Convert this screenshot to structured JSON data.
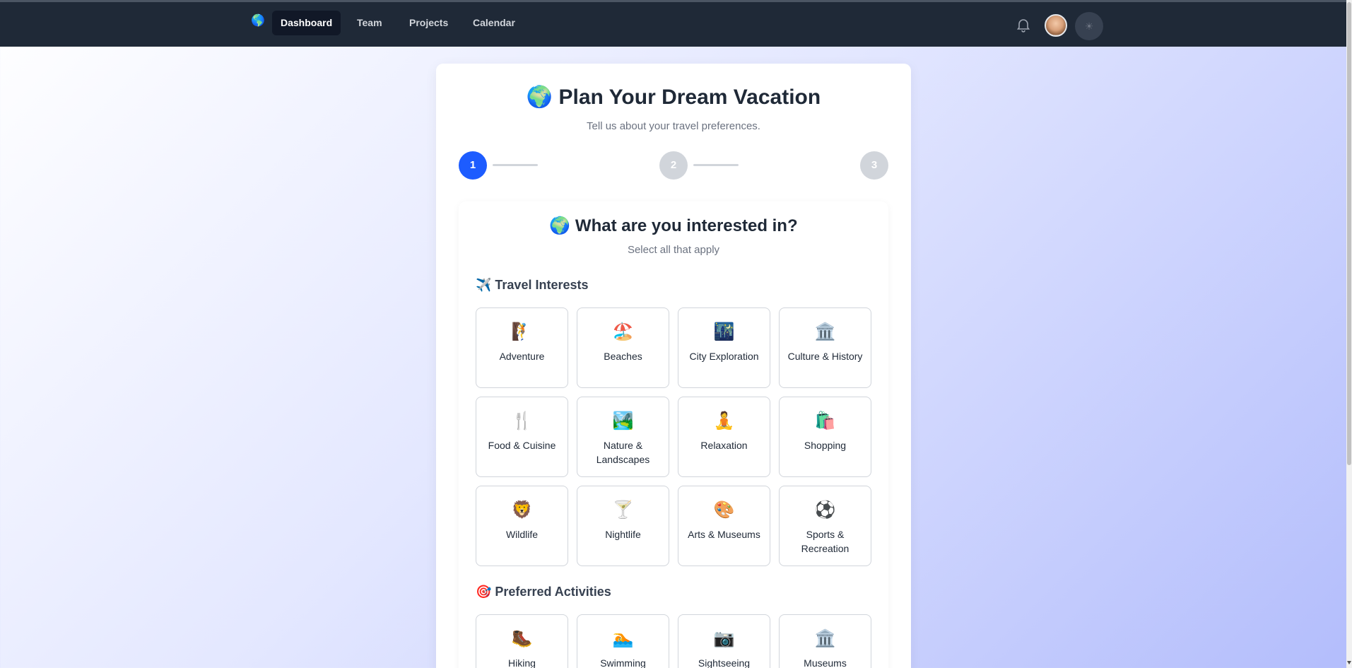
{
  "nav": {
    "logo_icon": "🌎",
    "items": [
      {
        "label": "Dashboard",
        "active": true
      },
      {
        "label": "Team",
        "active": false
      },
      {
        "label": "Projects",
        "active": false
      },
      {
        "label": "Calendar",
        "active": false
      }
    ],
    "theme_icon": "☀"
  },
  "page": {
    "title": "🌍 Plan Your Dream Vacation",
    "subtitle": "Tell us about your travel preferences."
  },
  "steps": [
    "1",
    "2",
    "3"
  ],
  "current_step": 1,
  "question": {
    "title": "🌍 What are you interested in?",
    "subtitle": "Select all that apply"
  },
  "sections": {
    "interests": {
      "heading": "✈️ Travel Interests",
      "items": [
        {
          "icon": "🧗",
          "label": "Adventure"
        },
        {
          "icon": "🏖️",
          "label": "Beaches"
        },
        {
          "icon": "🌃",
          "label": "City Exploration"
        },
        {
          "icon": "🏛️",
          "label": "Culture & History"
        },
        {
          "icon": "🍴",
          "label": "Food & Cuisine"
        },
        {
          "icon": "🏞️",
          "label": "Nature & Landscapes"
        },
        {
          "icon": "🧘",
          "label": "Relaxation"
        },
        {
          "icon": "🛍️",
          "label": "Shopping"
        },
        {
          "icon": "🦁",
          "label": "Wildlife"
        },
        {
          "icon": "🍸",
          "label": "Nightlife"
        },
        {
          "icon": "🎨",
          "label": "Arts & Museums"
        },
        {
          "icon": "⚽",
          "label": "Sports & Recreation"
        }
      ]
    },
    "activities": {
      "heading": "🎯 Preferred Activities",
      "items": [
        {
          "icon": "🥾",
          "label": "Hiking"
        },
        {
          "icon": "🏊",
          "label": "Swimming"
        },
        {
          "icon": "📷",
          "label": "Sightseeing"
        },
        {
          "icon": "🏛️",
          "label": "Museums"
        }
      ]
    }
  },
  "colors": {
    "accent": "#1d5cff",
    "navbar": "#1f2937"
  }
}
